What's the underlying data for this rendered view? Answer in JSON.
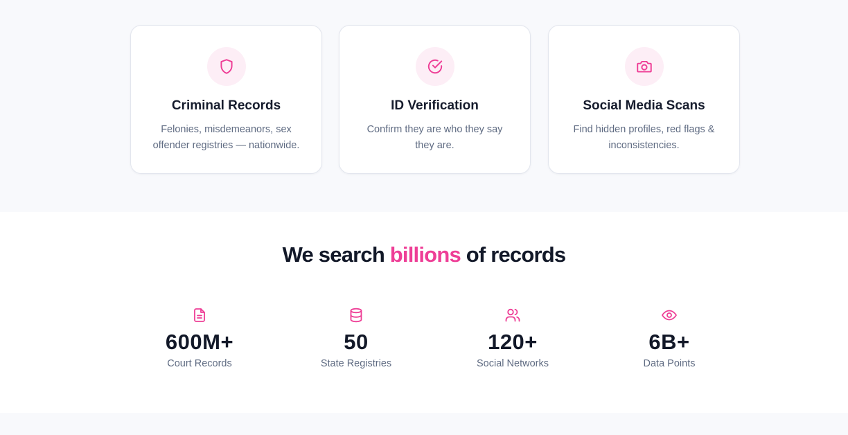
{
  "colors": {
    "accent": "#ee3e96",
    "icon_bg": "#fdeef6",
    "heading": "#121828",
    "muted": "#5f6b82"
  },
  "features": [
    {
      "icon": "shield-icon",
      "title": "Criminal Records",
      "description": "Felonies, misdemeanors, sex offender registries — nationwide."
    },
    {
      "icon": "check-circle-icon",
      "title": "ID Verification",
      "description": "Confirm they are who they say they are."
    },
    {
      "icon": "camera-icon",
      "title": "Social Media Scans",
      "description": "Find hidden profiles, red flags & inconsistencies."
    }
  ],
  "stats_section": {
    "heading_before": "We search ",
    "heading_accent": "billions",
    "heading_after": " of records",
    "stats": [
      {
        "icon": "document-icon",
        "value": "600M+",
        "label": "Court Records"
      },
      {
        "icon": "database-icon",
        "value": "50",
        "label": "State Registries"
      },
      {
        "icon": "users-icon",
        "value": "120+",
        "label": "Social Networks"
      },
      {
        "icon": "eye-icon",
        "value": "6B+",
        "label": "Data Points"
      }
    ]
  }
}
